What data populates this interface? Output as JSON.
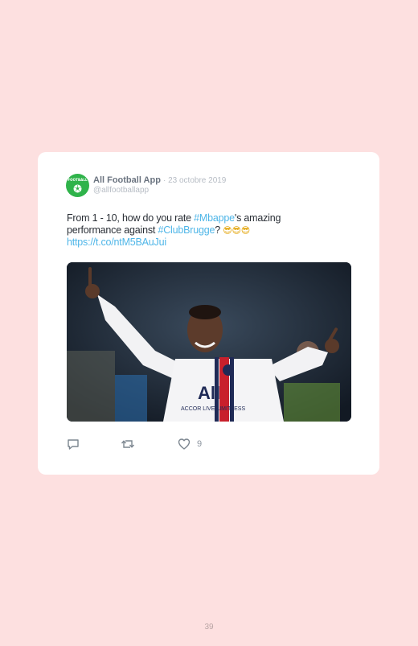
{
  "tweet": {
    "author": "All Football App",
    "date": "· 23 octobre 2019",
    "handle": "@allfootballapp",
    "avatar_text": "FOOTBALL",
    "text_part1": "From 1 - 10, how do you rate ",
    "hashtag1": "#Mbappe",
    "text_part2": "'s amazing performance against ",
    "hashtag2": "#ClubBrugge",
    "text_part3": "? ",
    "emojis": "😎😎😎",
    "link": "https://t.co/ntM5BAuJui",
    "photo_alt": "Kylian Mbappé celebrating with arms raised",
    "likes": "9"
  },
  "page": {
    "number": "39"
  },
  "colors": {
    "background": "#fde0e0",
    "card": "#ffffff",
    "link": "#4fb6e8",
    "avatar": "#2fb34a"
  }
}
